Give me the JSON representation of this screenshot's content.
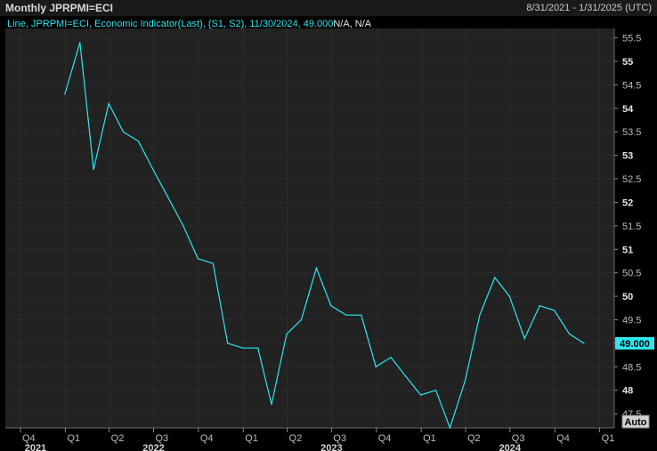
{
  "header": {
    "title": "Monthly JPRPMI=ECI",
    "date_range": "8/31/2021 - 1/31/2025 (UTC)"
  },
  "legend": {
    "text": "Line, JPRPMI=ECI, Economic Indicator(Last), (S1, S2), 11/30/2024, 49.000",
    "na_text": "N/A, N/A"
  },
  "controls": {
    "auto_label": "Auto"
  },
  "colors": {
    "background": "#000000",
    "plot_background": "#222222",
    "line": "#2ee6f0",
    "grid": "#3a3a3a",
    "last_value_badge": "#2ee6f0"
  },
  "chart_data": {
    "type": "line",
    "title": "",
    "xlabel": "",
    "ylabel": "",
    "ylim": [
      47.2,
      55.7
    ],
    "grid": true,
    "y_ticks": [
      "47.5",
      "48",
      "48.5",
      "49",
      "49.5",
      "50",
      "50.5",
      "51",
      "51.5",
      "52",
      "52.5",
      "53",
      "53.5",
      "54",
      "54.5",
      "55",
      "55.5"
    ],
    "y_tick_values": [
      47.5,
      48,
      48.5,
      49,
      49.5,
      50,
      50.5,
      51,
      51.5,
      52,
      52.5,
      53,
      53.5,
      54,
      54.5,
      55,
      55.5
    ],
    "x_quarter_ticks": [
      {
        "label": "Q4",
        "x": "2021-10-01"
      },
      {
        "label": "Q1",
        "x": "2022-01-01"
      },
      {
        "label": "Q2",
        "x": "2022-04-01"
      },
      {
        "label": "Q3",
        "x": "2022-07-01"
      },
      {
        "label": "Q4",
        "x": "2022-10-01"
      },
      {
        "label": "Q1",
        "x": "2023-01-01"
      },
      {
        "label": "Q2",
        "x": "2023-04-01"
      },
      {
        "label": "Q3",
        "x": "2023-07-01"
      },
      {
        "label": "Q4",
        "x": "2023-10-01"
      },
      {
        "label": "Q1",
        "x": "2024-01-01"
      },
      {
        "label": "Q2",
        "x": "2024-04-01"
      },
      {
        "label": "Q3",
        "x": "2024-07-01"
      },
      {
        "label": "Q4",
        "x": "2024-10-01"
      },
      {
        "label": "Q1",
        "x": "2025-01-01"
      }
    ],
    "x_year_ticks": [
      {
        "label": "2021",
        "x": "2021-11-01"
      },
      {
        "label": "2022",
        "x": "2022-07-01"
      },
      {
        "label": "2023",
        "x": "2023-07-01"
      },
      {
        "label": "2024",
        "x": "2024-07-01"
      }
    ],
    "last_value_label": "49.000",
    "last_value": 49.0,
    "series": [
      {
        "x": [
          "2021-12-31",
          "2022-01-31",
          "2022-02-28",
          "2022-03-31",
          "2022-04-30",
          "2022-05-31",
          "2022-06-30",
          "2022-07-31",
          "2022-08-31",
          "2022-09-30",
          "2022-10-31",
          "2022-11-30",
          "2022-12-31",
          "2023-01-31",
          "2023-02-28",
          "2023-03-31",
          "2023-04-30",
          "2023-05-31",
          "2023-06-30",
          "2023-07-31",
          "2023-08-31",
          "2023-09-30",
          "2023-10-31",
          "2023-11-30",
          "2023-12-31",
          "2024-01-31",
          "2024-02-29",
          "2024-03-31",
          "2024-04-30",
          "2024-05-31",
          "2024-06-30",
          "2024-07-31",
          "2024-08-31",
          "2024-09-30",
          "2024-10-31",
          "2024-11-30"
        ],
        "values": [
          54.3,
          55.4,
          52.7,
          54.1,
          53.5,
          53.3,
          52.7,
          52.1,
          51.5,
          50.8,
          50.7,
          49.0,
          48.9,
          48.9,
          47.7,
          49.2,
          49.5,
          50.6,
          49.8,
          49.6,
          49.6,
          48.5,
          48.7,
          48.3,
          47.9,
          48.0,
          47.2,
          48.2,
          49.6,
          50.4,
          50.0,
          49.1,
          49.8,
          49.7,
          49.2,
          49.0
        ]
      }
    ]
  }
}
